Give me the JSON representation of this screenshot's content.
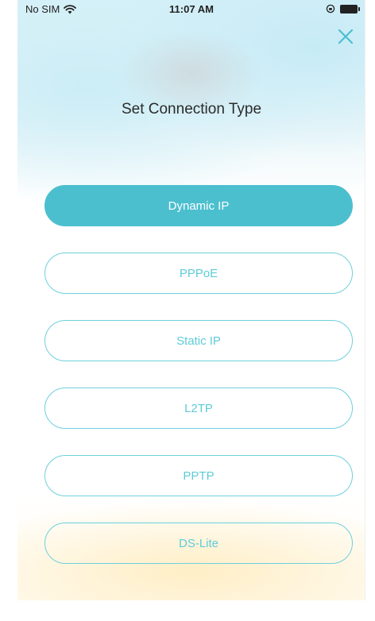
{
  "status_bar": {
    "carrier": "No SIM",
    "time": "11:07 AM"
  },
  "header": {
    "title": "Set Connection Type"
  },
  "connection_types": [
    {
      "label": "Dynamic IP",
      "selected": true
    },
    {
      "label": "PPPoE",
      "selected": false
    },
    {
      "label": "Static IP",
      "selected": false
    },
    {
      "label": "L2TP",
      "selected": false
    },
    {
      "label": "PPTP",
      "selected": false
    },
    {
      "label": "DS-Lite",
      "selected": false
    }
  ],
  "colors": {
    "accent": "#4cbfcf",
    "outline": "#6dd0dc",
    "text": "#2b2b2b"
  },
  "icons": {
    "close": "close-icon",
    "wifi": "wifi-icon",
    "battery": "battery-icon",
    "orientation_lock": "lock-icon"
  }
}
